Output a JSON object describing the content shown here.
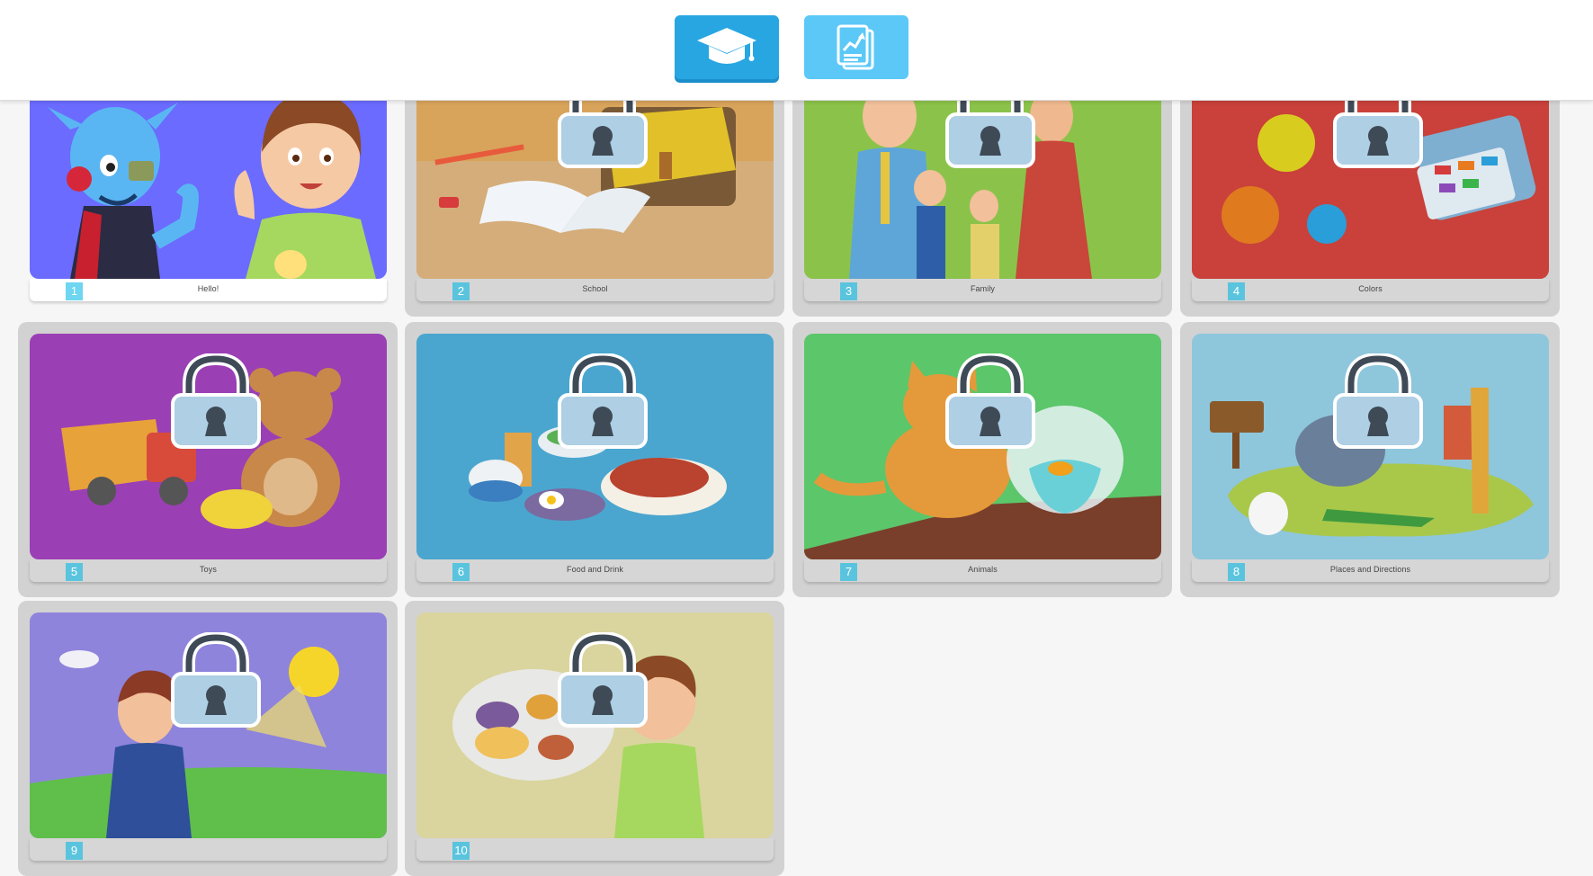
{
  "header": {
    "tabs": [
      {
        "name": "lessons",
        "icon": "graduation-cap-icon",
        "color": "#27a6e2",
        "active": true
      },
      {
        "name": "reports",
        "icon": "report-chart-icon",
        "color": "#5bc8f7",
        "active": false
      }
    ]
  },
  "units": [
    {
      "number": "1",
      "title": "Hello!",
      "locked": false,
      "bg": "#6b6bff"
    },
    {
      "number": "2",
      "title": "School",
      "locked": true,
      "bg": "#d8a45b"
    },
    {
      "number": "3",
      "title": "Family",
      "locked": true,
      "bg": "#8bc34a"
    },
    {
      "number": "4",
      "title": "Colors",
      "locked": true,
      "bg": "#c9413a"
    },
    {
      "number": "5",
      "title": "Toys",
      "locked": true,
      "bg": "#9b3fb5"
    },
    {
      "number": "6",
      "title": "Food and Drink",
      "locked": true,
      "bg": "#4aa6cf"
    },
    {
      "number": "7",
      "title": "Animals",
      "locked": true,
      "bg": "#5cc66a"
    },
    {
      "number": "8",
      "title": "Places and Directions",
      "locked": true,
      "bg": "#8ec6dc"
    },
    {
      "number": "9",
      "title": "",
      "locked": true,
      "bg": "#8e84dc"
    },
    {
      "number": "10",
      "title": "",
      "locked": true,
      "bg": "#dad59e"
    }
  ]
}
